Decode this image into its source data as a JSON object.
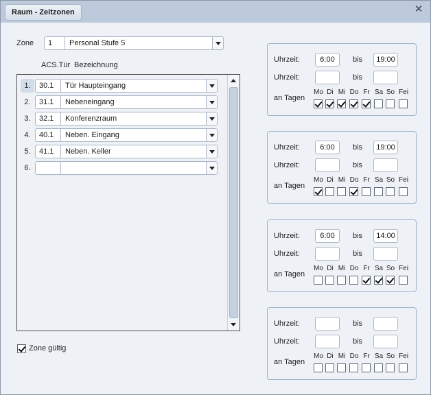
{
  "window": {
    "title": "Raum - Zeitzonen"
  },
  "zone": {
    "label": "Zone",
    "number": "1",
    "name": "Personal Stufe 5",
    "valid_label": "Zone gültig",
    "valid_checked": true
  },
  "list": {
    "col_acs": "ACS.Tür",
    "col_name": "Bezeichnung",
    "rows": [
      {
        "num": "1.",
        "acs": "30.1",
        "name": "Tür Haupteingang",
        "selected": true
      },
      {
        "num": "2.",
        "acs": "31.1",
        "name": "Nebeneingang",
        "selected": false
      },
      {
        "num": "3.",
        "acs": "32.1",
        "name": "Konferenzraum",
        "selected": false
      },
      {
        "num": "4.",
        "acs": "40.1",
        "name": "Neben. Eingang",
        "selected": false
      },
      {
        "num": "5.",
        "acs": "41.1",
        "name": "Neben. Keller",
        "selected": false
      },
      {
        "num": "6.",
        "acs": "",
        "name": "",
        "selected": false
      }
    ]
  },
  "labels": {
    "uhrzeit": "Uhrzeit:",
    "bis": "bis",
    "an_tagen": "an Tagen"
  },
  "days": [
    "Mo",
    "Di",
    "Mi",
    "Do",
    "Fr",
    "Sa",
    "So",
    "Fei"
  ],
  "time_panels": [
    {
      "from1": "6:00",
      "to1": "19:00",
      "from2": "",
      "to2": "",
      "days": [
        true,
        true,
        true,
        true,
        true,
        false,
        false,
        false
      ]
    },
    {
      "from1": "6:00",
      "to1": "19:00",
      "from2": "",
      "to2": "",
      "days": [
        true,
        false,
        false,
        true,
        false,
        false,
        false,
        false
      ]
    },
    {
      "from1": "6:00",
      "to1": "14:00",
      "from2": "",
      "to2": "",
      "days": [
        false,
        false,
        false,
        false,
        true,
        true,
        true,
        false
      ]
    },
    {
      "from1": "",
      "to1": "",
      "from2": "",
      "to2": "",
      "days": [
        false,
        false,
        false,
        false,
        false,
        false,
        false,
        false
      ]
    }
  ],
  "colors": {
    "titlebar": "#bccadb",
    "background": "#eef2f7",
    "border": "#a9b6c6"
  }
}
